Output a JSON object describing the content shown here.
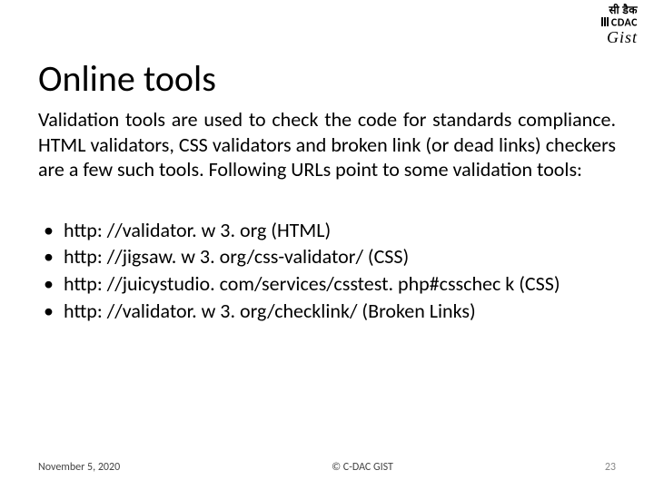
{
  "logo": {
    "hindi": "सी डैक",
    "cdac": "CDAC",
    "gist": "Gist"
  },
  "title": "Online tools",
  "paragraph": "Validation tools are used to check the code for standards compliance. HTML validators, CSS validators and broken link (or dead links) checkers are a few such tools. Following URLs point to some validation tools:",
  "bullet": "•",
  "items": [
    "http: //validator. w 3. org (HTML)",
    "http: //jigsaw. w 3. org/css-validator/ (CSS)",
    "http: //juicystudio. com/services/csstest. php#csschec k (CSS)",
    "http: //validator. w 3. org/checklink/ (Broken Links)"
  ],
  "footer": {
    "date": "November 5, 2020",
    "copyright": "© C-DAC GIST",
    "page": "23"
  }
}
